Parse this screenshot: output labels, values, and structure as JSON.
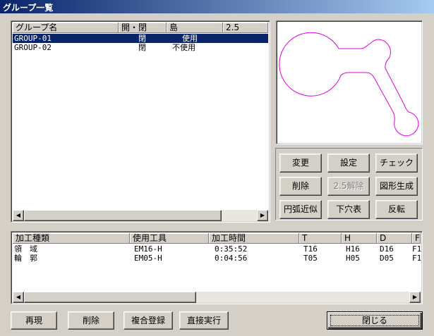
{
  "window": {
    "title": "グループ一覧"
  },
  "group_list": {
    "columns": [
      "グループ名",
      "開・閉",
      "島",
      "2.5"
    ],
    "rows": [
      {
        "name": "GROUP-01",
        "open_close": "閉",
        "island": "使用",
        "selected": true
      },
      {
        "name": "GROUP-02",
        "open_close": "閉",
        "island": "不使用",
        "selected": false
      }
    ]
  },
  "preview": {
    "stroke_color": "#e000e0"
  },
  "group_buttons": {
    "change": "変更",
    "settings": "設定",
    "check": "チェック",
    "delete": "削除",
    "release_25": "2.5解除",
    "shape_generate": "図形生成",
    "arc_approx": "円弧近似",
    "pilot_hole": "下穴表",
    "reverse": "反転"
  },
  "process_list": {
    "columns": [
      "加工種類",
      "使用工具",
      "加工時間",
      "T",
      "H",
      "D",
      "F"
    ],
    "rows": [
      {
        "type": "領　域",
        "tool": "EM16-H",
        "time": "0:35:52",
        "t": "T16",
        "h": "H16",
        "d": "D16",
        "f": "F1"
      },
      {
        "type": "輪　郭",
        "tool": "EM05-H",
        "time": "0:04:56",
        "t": "T05",
        "h": "H05",
        "d": "D05",
        "f": "F1"
      }
    ]
  },
  "bottom_buttons": {
    "reproduce": "再現",
    "delete": "削除",
    "compound_register": "複合登録",
    "direct_execute": "直接実行",
    "close": "閉じる"
  }
}
